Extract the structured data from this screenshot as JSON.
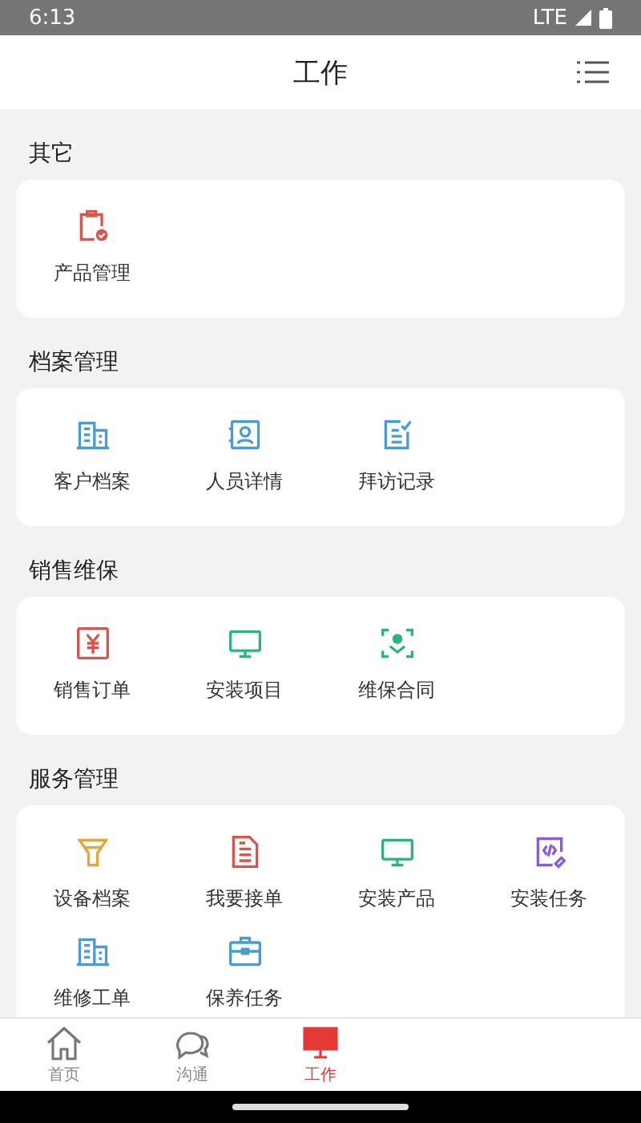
{
  "status_bar": {
    "time": "6:13",
    "network": "LTE"
  },
  "header": {
    "title": "工作"
  },
  "sections": [
    {
      "title": "其它",
      "items": [
        {
          "label": "产品管理",
          "color": "#d9534f"
        }
      ]
    },
    {
      "title": "档案管理",
      "items": [
        {
          "label": "客户档案",
          "color": "#4a9bd1"
        },
        {
          "label": "人员详情",
          "color": "#4a9bd1"
        },
        {
          "label": "拜访记录",
          "color": "#4a9bd1"
        }
      ]
    },
    {
      "title": "销售维保",
      "items": [
        {
          "label": "销售订单",
          "color": "#d9534f"
        },
        {
          "label": "安装项目",
          "color": "#2db37e"
        },
        {
          "label": "维保合同",
          "color": "#2db37e"
        }
      ]
    },
    {
      "title": "服务管理",
      "items": [
        {
          "label": "设备档案",
          "color": "#e8a33a"
        },
        {
          "label": "我要接单",
          "color": "#d9534f"
        },
        {
          "label": "安装产品",
          "color": "#2db37e"
        },
        {
          "label": "安装任务",
          "color": "#8c5cd6"
        },
        {
          "label": "维修工单",
          "color": "#4a9bd1"
        },
        {
          "label": "保养任务",
          "color": "#4a9bd1"
        }
      ]
    }
  ],
  "tabs": [
    {
      "label": "首页",
      "selected": false
    },
    {
      "label": "沟通",
      "selected": false
    },
    {
      "label": "工作",
      "selected": true
    }
  ]
}
